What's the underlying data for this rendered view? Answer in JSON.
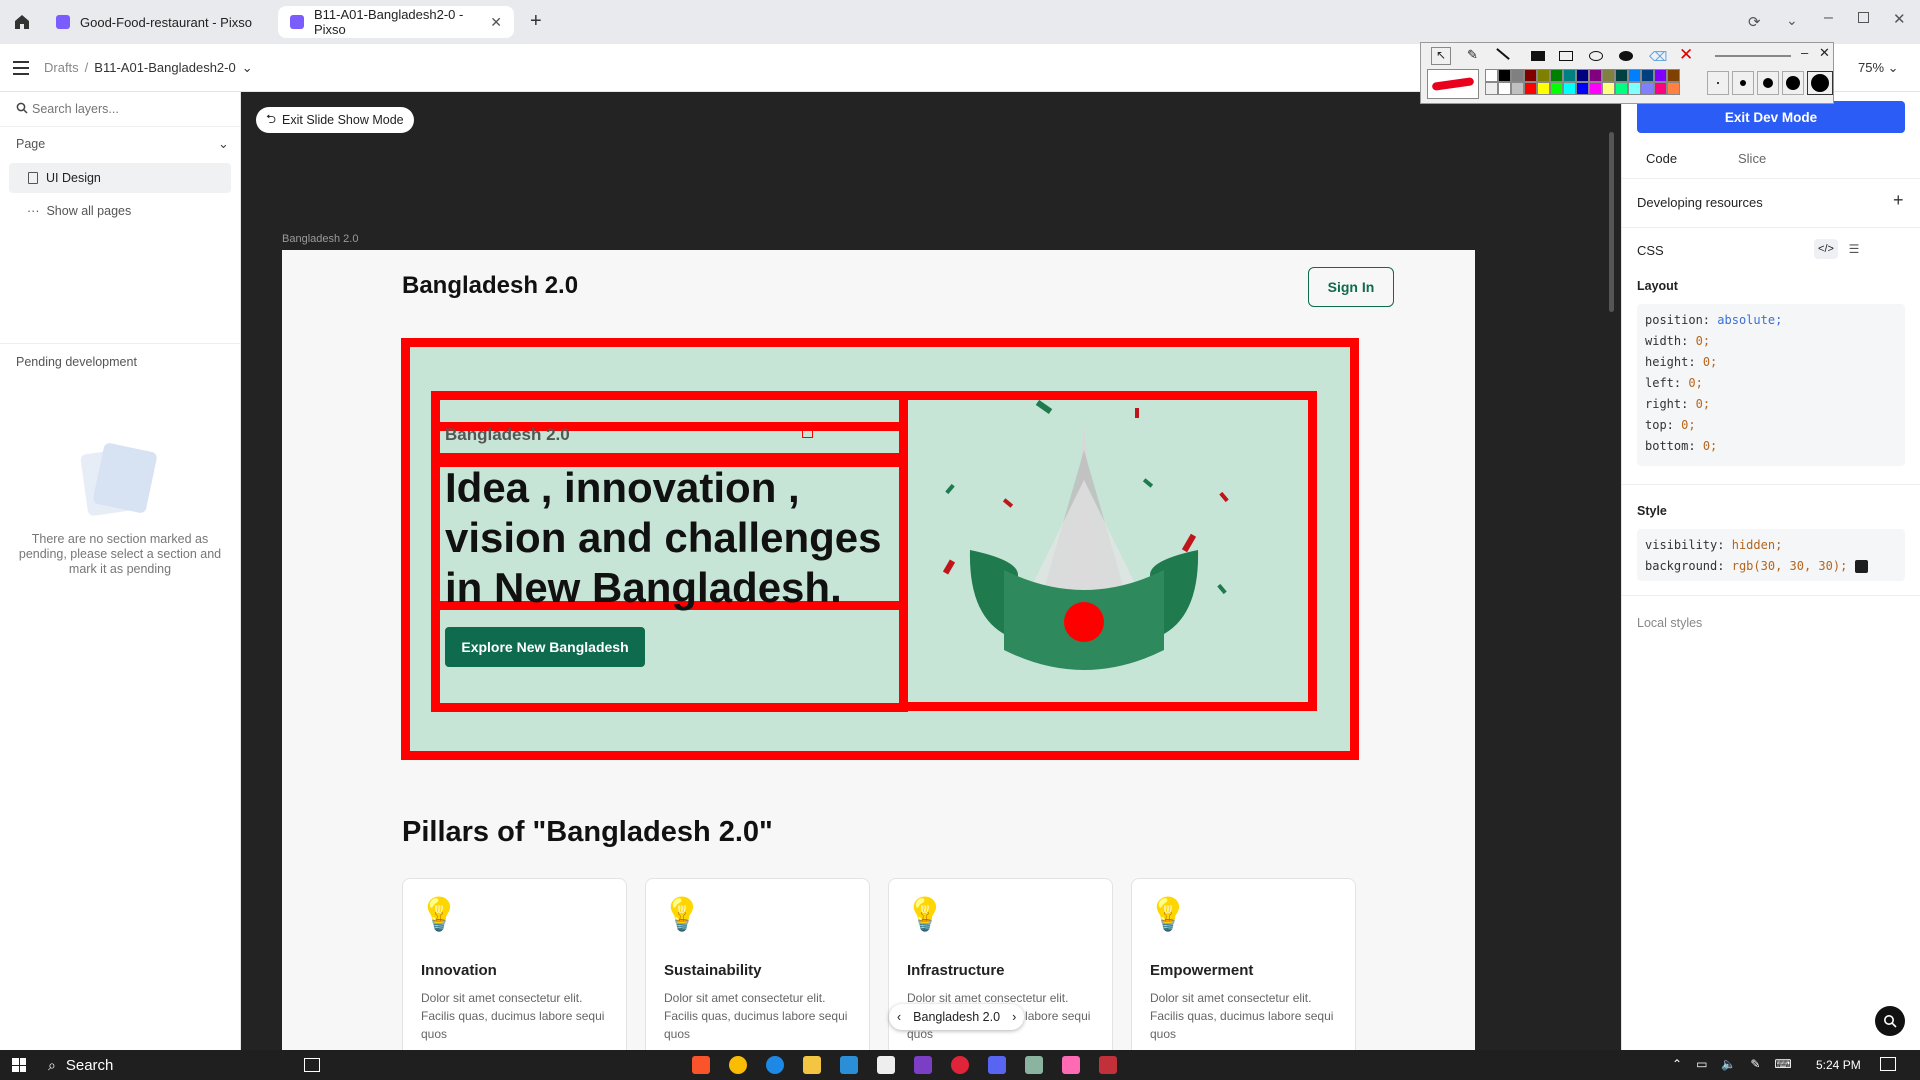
{
  "browser": {
    "tabs": [
      {
        "label": "Good-Food-restaurant - Pixso"
      },
      {
        "label": "B11-A01-Bangladesh2-0 - Pixso"
      }
    ],
    "new_tab": "+",
    "close": "✕"
  },
  "app": {
    "breadcrumb_root": "Drafts",
    "breadcrumb_sep": "/",
    "file_name": "B11-A01-Bangladesh2-0",
    "zoom": "75%",
    "exit_dev_mode": "Exit Dev Mode",
    "exit_slideshow": "Exit Slide Show Mode"
  },
  "left_panel": {
    "search_placeholder": "Search layers...",
    "page_heading": "Page",
    "pages": [
      {
        "label": "UI Design"
      }
    ],
    "show_all": "Show all pages",
    "pending_title": "Pending development",
    "pending_empty": "There are no section marked as pending, please select a section and mark it as pending"
  },
  "right_panel": {
    "tabs": [
      "Code",
      "Slice"
    ],
    "dev_resources": "Developing resources",
    "css_label": "CSS",
    "layout_label": "Layout",
    "layout_props": [
      {
        "k": "position:",
        "v": "absolute;"
      },
      {
        "k": "width:",
        "v": "0;"
      },
      {
        "k": "height:",
        "v": "0;"
      },
      {
        "k": "left:",
        "v": "0;"
      },
      {
        "k": "right:",
        "v": "0;"
      },
      {
        "k": "top:",
        "v": "0;"
      },
      {
        "k": "bottom:",
        "v": "0;"
      }
    ],
    "style_label": "Style",
    "style_props": [
      {
        "k": "visibility:",
        "v": "hidden;"
      },
      {
        "k": "background:",
        "v": "rgb(30, 30, 30);"
      }
    ],
    "local_styles": "Local styles"
  },
  "canvas": {
    "frame_label": "Bangladesh 2.0",
    "site": {
      "brand": "Bangladesh 2.0",
      "sign_in": "Sign In",
      "hero_kicker": "Bangladesh 2.0",
      "hero_title": "Idea , innovation , vision and challenges in New Bangladesh.",
      "hero_cta": "Explore New Bangladesh",
      "pillars_heading": "Pillars of \"Bangladesh 2.0\"",
      "pillars": [
        {
          "title": "Innovation",
          "body": "Dolor sit amet consectetur elit. Facilis quas, ducimus labore sequi quos"
        },
        {
          "title": "Sustainability",
          "body": "Dolor sit amet consectetur elit. Facilis quas, ducimus labore sequi quos"
        },
        {
          "title": "Infrastructure",
          "body": "Dolor sit amet consectetur elit. Facilis quas, ducimus labore sequi quos"
        },
        {
          "title": "Empowerment",
          "body": "Dolor sit amet consectetur elit. Facilis quas, ducimus labore sequi quos"
        }
      ]
    },
    "slide_nav_label": "Bangladesh 2.0"
  },
  "taskbar": {
    "search": "Search",
    "time": "5:24 PM"
  },
  "colors": {
    "accent_blue": "#2b5cf6",
    "brand_green": "#0f6b4e",
    "hero_bg": "#c7e5d6",
    "annotation_red": "#ff0000"
  }
}
